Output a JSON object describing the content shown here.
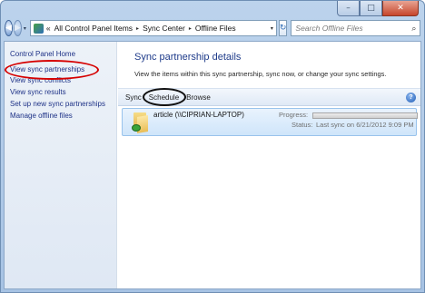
{
  "titlebar": {
    "minimize_label": "–",
    "maximize_label": "□",
    "close_label": "✕"
  },
  "nav": {
    "back_icon": "◀",
    "forward_icon": "▶",
    "dropdown_icon": "▾",
    "refresh_icon": "↻"
  },
  "address": {
    "prefix": "«",
    "crumbs": [
      "All Control Panel Items",
      "Sync Center",
      "Offline Files"
    ],
    "separator": "▸",
    "dropdown": "▾"
  },
  "search": {
    "placeholder": "Search Offline Files",
    "icon": "⌕"
  },
  "sidebar": {
    "home": "Control Panel Home",
    "items": [
      "View sync partnerships",
      "View sync conflicts",
      "View sync results",
      "Set up new sync partnerships",
      "Manage offline files"
    ]
  },
  "main": {
    "title": "Sync partnership details",
    "description": "View the items within this sync partnership, sync now, or change your sync settings."
  },
  "toolbar": {
    "sync": "Sync",
    "schedule": "Schedule",
    "browse": "Browse",
    "help": "?"
  },
  "item": {
    "name": "article (\\\\CIPRIAN-LAPTOP)",
    "progress_label": "Progress:",
    "status_label": "Status:",
    "status_value": "Last sync on 6/21/2012 9:09 PM"
  },
  "colors": {
    "highlight_red": "#d60000",
    "highlight_black": "#111111",
    "link_blue": "#1e3287",
    "title_blue": "#1e3b8a"
  }
}
